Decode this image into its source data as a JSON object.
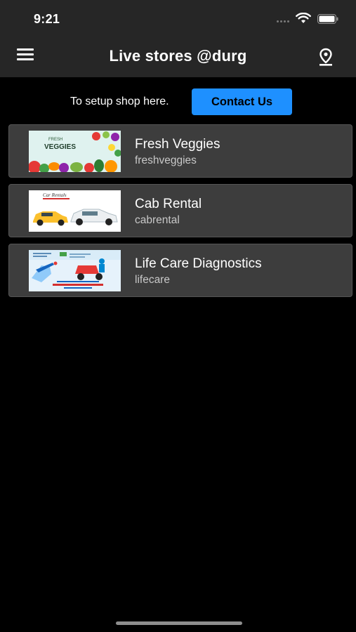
{
  "status_bar": {
    "time": "9:21"
  },
  "app_bar": {
    "title": "Live stores @durg",
    "menu_icon": "menu-icon",
    "location_icon": "location-pin-icon"
  },
  "setup": {
    "text": "To setup shop here.",
    "contact_label": "Contact Us"
  },
  "stores": [
    {
      "name": "Fresh Veggies",
      "slug": "freshveggies",
      "thumb_text": [
        "FRESH",
        "VEGGIES"
      ]
    },
    {
      "name": "Cab Rental",
      "slug": "cabrental",
      "thumb_text": [
        "Car Rentals"
      ]
    },
    {
      "name": "Life Care Diagnostics",
      "slug": "lifecare",
      "thumb_text": []
    }
  ],
  "colors": {
    "accent": "#1e90ff",
    "bar_bg": "#262626",
    "card_bg": "#3d3d3d",
    "page_bg": "#000000"
  }
}
